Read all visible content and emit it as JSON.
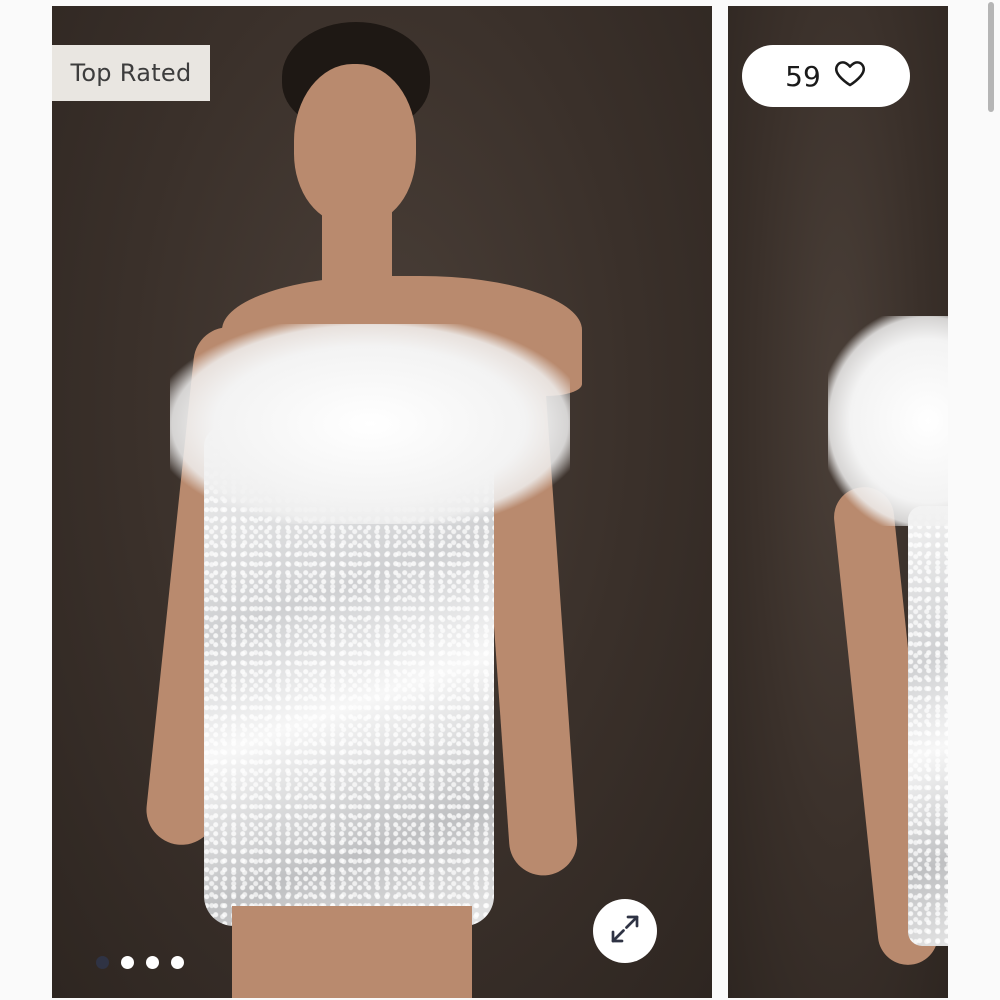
{
  "gallery": {
    "badge_label": "Top Rated",
    "likes": {
      "count": "59",
      "icon": "heart-icon"
    },
    "expand_icon": "expand-icon",
    "carousel": {
      "total_slides": 4,
      "active_index": 0
    },
    "colors": {
      "backdrop": "#3a302a",
      "badge_bg": "#e9e6e1",
      "active_dot": "#2f3344"
    }
  }
}
